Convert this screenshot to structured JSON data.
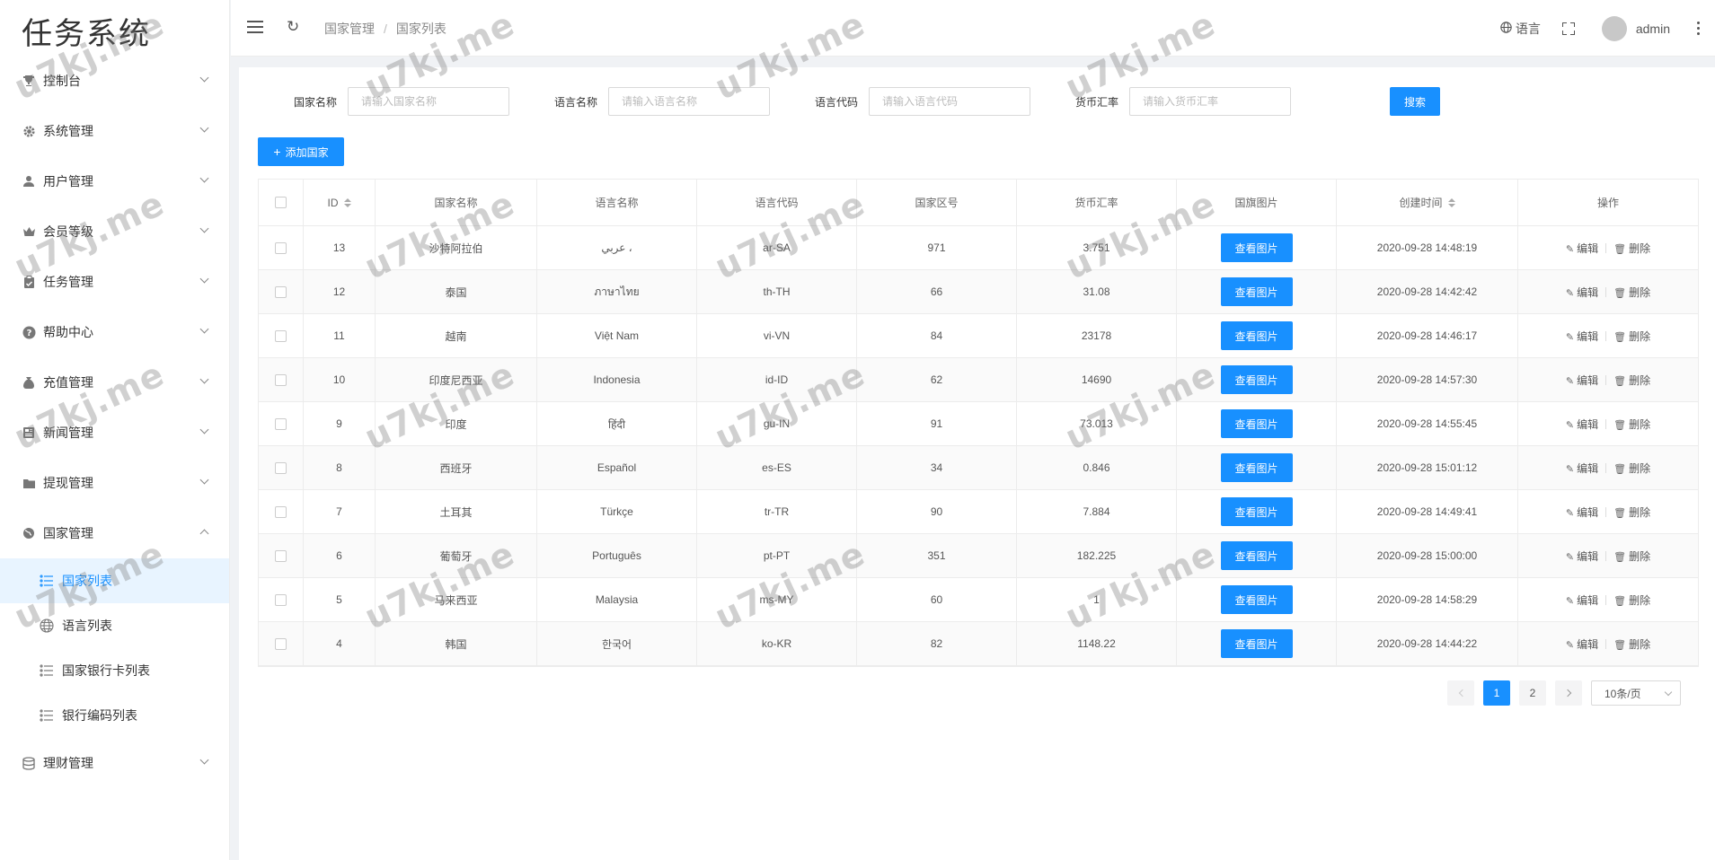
{
  "sidebar": {
    "logo": "任务系统",
    "menu": [
      {
        "label": "控制台",
        "icon": "trophy-icon"
      },
      {
        "label": "系统管理",
        "icon": "gear-icon"
      },
      {
        "label": "用户管理",
        "icon": "user-icon"
      },
      {
        "label": "会员等级",
        "icon": "crown-icon"
      },
      {
        "label": "任务管理",
        "icon": "clipboard-icon"
      },
      {
        "label": "帮助中心",
        "icon": "question-icon"
      },
      {
        "label": "充值管理",
        "icon": "moneybag-icon"
      },
      {
        "label": "新闻管理",
        "icon": "news-icon"
      },
      {
        "label": "提现管理",
        "icon": "wallet-icon"
      },
      {
        "label": "国家管理",
        "icon": "globe-icon"
      }
    ],
    "submenu": [
      {
        "label": "国家列表",
        "icon": "list-icon"
      },
      {
        "label": "语言列表",
        "icon": "globe-icon"
      },
      {
        "label": "国家银行卡列表",
        "icon": "list-icon"
      },
      {
        "label": "银行编码列表",
        "icon": "list-icon"
      }
    ],
    "last_menu": {
      "label": "理财管理",
      "icon": "database-icon"
    }
  },
  "header": {
    "breadcrumb": [
      "国家管理",
      "国家列表"
    ],
    "language_label": "语言",
    "username": "admin"
  },
  "search": {
    "fields": [
      {
        "label": "国家名称",
        "placeholder": "请输入国家名称"
      },
      {
        "label": "语言名称",
        "placeholder": "请输入语言名称"
      },
      {
        "label": "语言代码",
        "placeholder": "请输入语言代码"
      },
      {
        "label": "货币汇率",
        "placeholder": "请输入货币汇率"
      }
    ],
    "search_button": "搜索"
  },
  "toolbar": {
    "add_button": "添加国家"
  },
  "table": {
    "columns": [
      "ID",
      "国家名称",
      "语言名称",
      "语言代码",
      "国家区号",
      "货币汇率",
      "国旗图片",
      "创建时间",
      "操作"
    ],
    "view_button": "查看图片",
    "edit_label": "编辑",
    "delete_label": "删除",
    "rows": [
      {
        "id": "13",
        "country": "沙特阿拉伯",
        "language": "عربي ،",
        "code": "ar-SA",
        "area": "971",
        "rate": "3.751",
        "created": "2020-09-28 14:48:19"
      },
      {
        "id": "12",
        "country": "泰国",
        "language": "ภาษาไทย",
        "code": "th-TH",
        "area": "66",
        "rate": "31.08",
        "created": "2020-09-28 14:42:42"
      },
      {
        "id": "11",
        "country": "越南",
        "language": "Việt Nam",
        "code": "vi-VN",
        "area": "84",
        "rate": "23178",
        "created": "2020-09-28 14:46:17"
      },
      {
        "id": "10",
        "country": "印度尼西亚",
        "language": "Indonesia",
        "code": "id-ID",
        "area": "62",
        "rate": "14690",
        "created": "2020-09-28 14:57:30"
      },
      {
        "id": "9",
        "country": "印度",
        "language": "हिंदी",
        "code": "gu-IN",
        "area": "91",
        "rate": "73.013",
        "created": "2020-09-28 14:55:45"
      },
      {
        "id": "8",
        "country": "西班牙",
        "language": "Español",
        "code": "es-ES",
        "area": "34",
        "rate": "0.846",
        "created": "2020-09-28 15:01:12"
      },
      {
        "id": "7",
        "country": "土耳其",
        "language": "Türkçe",
        "code": "tr-TR",
        "area": "90",
        "rate": "7.884",
        "created": "2020-09-28 14:49:41"
      },
      {
        "id": "6",
        "country": "葡萄牙",
        "language": "Português",
        "code": "pt-PT",
        "area": "351",
        "rate": "182.225",
        "created": "2020-09-28 15:00:00"
      },
      {
        "id": "5",
        "country": "马来西亚",
        "language": "Malaysia",
        "code": "ms-MY",
        "area": "60",
        "rate": "1",
        "created": "2020-09-28 14:58:29"
      },
      {
        "id": "4",
        "country": "韩国",
        "language": "한국어",
        "code": "ko-KR",
        "area": "82",
        "rate": "1148.22",
        "created": "2020-09-28 14:44:22"
      }
    ]
  },
  "pagination": {
    "pages": [
      "1",
      "2"
    ],
    "current": "1",
    "page_size": "10条/页"
  },
  "watermark": "u7kj.me",
  "colors": {
    "accent": "#1890ff",
    "active_bg": "#e8f4ff"
  }
}
